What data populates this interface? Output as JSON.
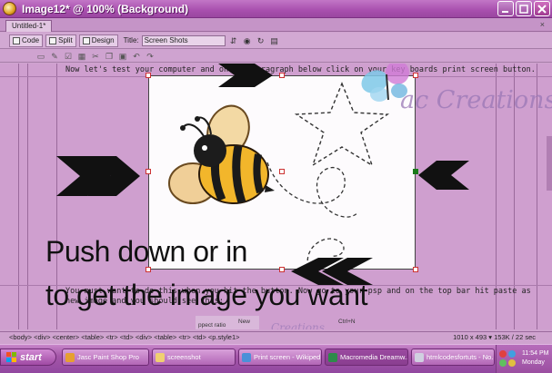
{
  "window": {
    "title": "Image12* @ 100% (Background)",
    "buttons": [
      "minimize",
      "maximize",
      "close"
    ]
  },
  "document_tab": {
    "label": "Untitled-1*",
    "close": "×"
  },
  "toolbar": {
    "code_label": "Code",
    "split_label": "Split",
    "design_label": "Design",
    "title_label": "Title:",
    "title_value": "Screen Shots"
  },
  "page": {
    "line1": "Now let's test your computer and on the paragraph below click on your key boards print screen button.",
    "line2a": "You must want to do this when you hit the button. Now go to your psp and on the top bar hit paste as",
    "line2b": "new image and you should see this:"
  },
  "image": {
    "watermark": "ac Creations",
    "ghost_new": "New",
    "ghost_ctrl": "Ctrl+N",
    "ghost_watermark": "Creations",
    "ghost_caption": "ppect ratio"
  },
  "overlay": {
    "line1": "Push down or in",
    "line2": "to get the image you want"
  },
  "status": {
    "tag_selector": "<body> <div> <center> <table> <tr> <td> <div> <table> <tr> <td> <p.style1>",
    "dimensions": "1010 x 493 ▾ 153K / 22 sec"
  },
  "taskbar": {
    "start_label": "start",
    "tasks": [
      "Jasc Paint Shop Pro",
      "screenshot",
      "Print screen - Wikiped...",
      "Macromedia Dreamw...",
      "htmlcodesfortuts - No..."
    ],
    "clock": "11:54 PM",
    "day": "Monday"
  },
  "colors": {
    "titlebar": "#a84fae",
    "editor_bg": "#cf9fcf",
    "taskbar": "#9248a0",
    "arrow": "#111111"
  }
}
